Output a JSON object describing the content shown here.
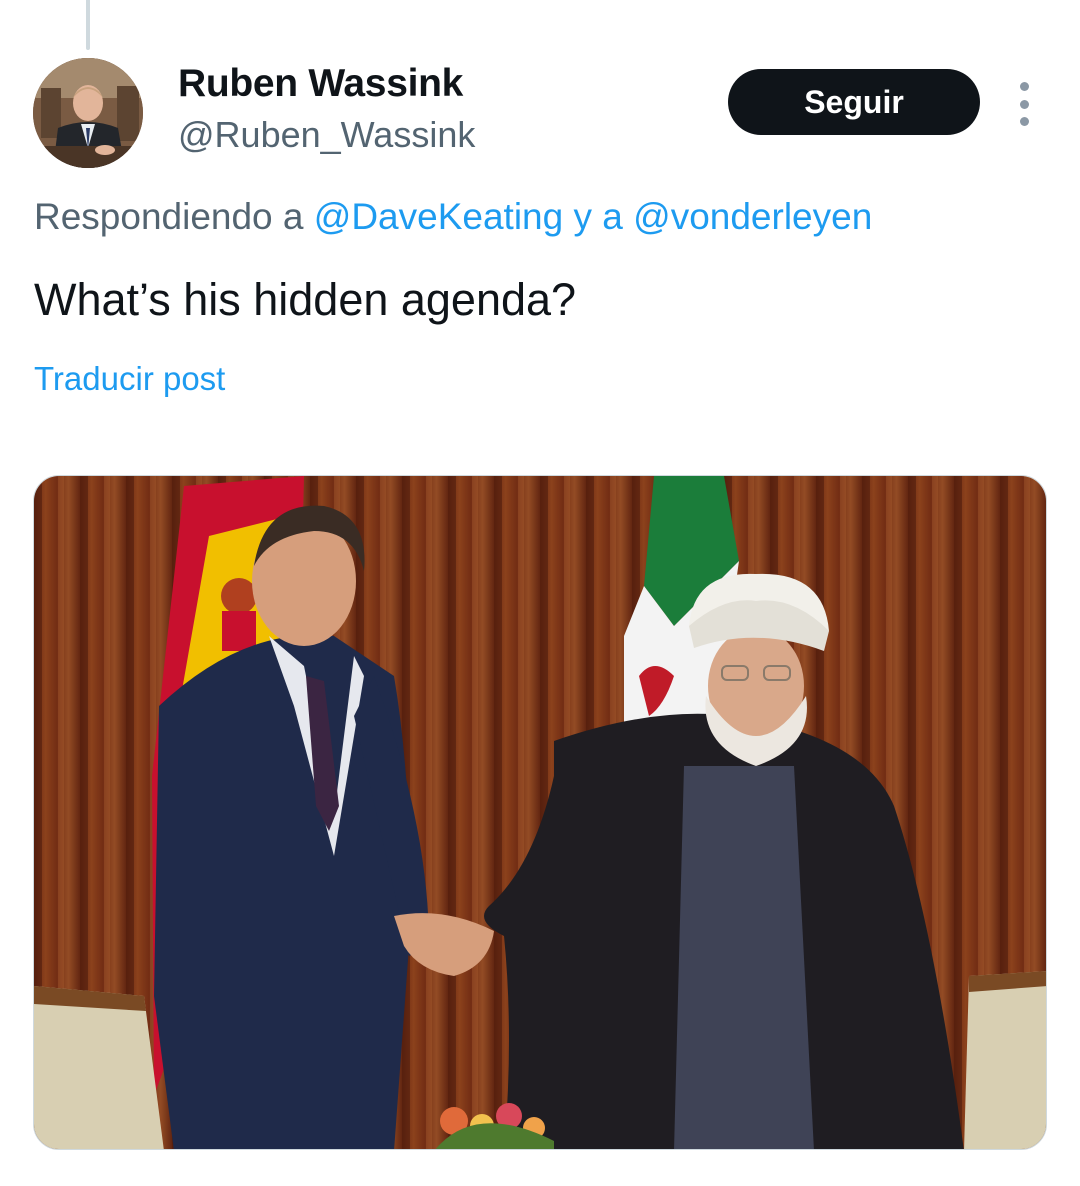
{
  "author": {
    "display_name": "Ruben Wassink",
    "handle": "@Ruben_Wassink",
    "avatar_icon": "profile-photo"
  },
  "actions": {
    "follow_label": "Seguir",
    "more_icon": "more-vertical-icon"
  },
  "reply_context": {
    "prefix": "Respondiendo a ",
    "mention_1": "@DaveKeating",
    "separator": " y a ",
    "mention_2": "@vonderleyen"
  },
  "post": {
    "text": "What’s his hidden agenda?",
    "translate_label": "Traducir post"
  },
  "colors": {
    "accent": "#1d9bf0",
    "secondary_text": "#536471",
    "follow_button_bg": "#0f1419"
  }
}
